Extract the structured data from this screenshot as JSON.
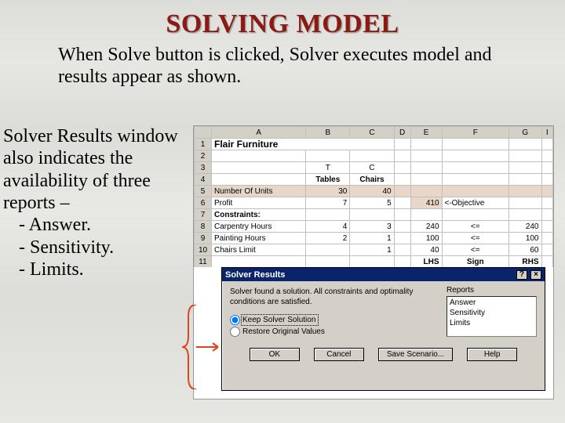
{
  "title": "SOLVING MODEL",
  "intro": "When Solve button is clicked, Solver executes model and results appear as shown.",
  "left_para": "Solver Results window also indicates the availability of three reports –",
  "bullets": [
    "-  Answer.",
    "-  Sensitivity.",
    "-  Limits."
  ],
  "sheet": {
    "cols": [
      "",
      "A",
      "B",
      "C",
      "D",
      "E",
      "F",
      "G",
      "I"
    ],
    "a1": "Flair Furniture",
    "r3": {
      "b": "T",
      "c": "C"
    },
    "r4": {
      "b": "Tables",
      "c": "Chairs"
    },
    "r5": {
      "a": "Number Of Units",
      "b": "30",
      "c": "40"
    },
    "r6": {
      "a": "Profit",
      "b": "7",
      "c": "5",
      "e": "410",
      "f": "<-Objective"
    },
    "r7": {
      "a": "Constraints:"
    },
    "r8": {
      "a": "Carpentry Hours",
      "b": "4",
      "c": "3",
      "e": "240",
      "ef": "<=",
      "g": "240"
    },
    "r9": {
      "a": "Painting Hours",
      "b": "2",
      "c": "1",
      "e": "100",
      "ef": "<=",
      "g": "100"
    },
    "r10": {
      "a": "Chairs Limit",
      "b": "",
      "c": "1",
      "e": "40",
      "ef": "<=",
      "g": "60"
    },
    "r11": {
      "e": "LHS",
      "f": "Sign",
      "g": "RHS"
    }
  },
  "dialog": {
    "title": "Solver Results",
    "help_glyph": "?",
    "close_glyph": "×",
    "msg": "Solver found a solution. All constraints and optimality conditions are satisfied.",
    "reports_label": "Reports",
    "reports": [
      "Answer",
      "Sensitivity",
      "Limits"
    ],
    "opt_keep": "Keep Solver Solution",
    "opt_restore": "Restore Original Values",
    "btn_ok": "OK",
    "btn_cancel": "Cancel",
    "btn_save": "Save Scenario...",
    "btn_help": "Help"
  }
}
